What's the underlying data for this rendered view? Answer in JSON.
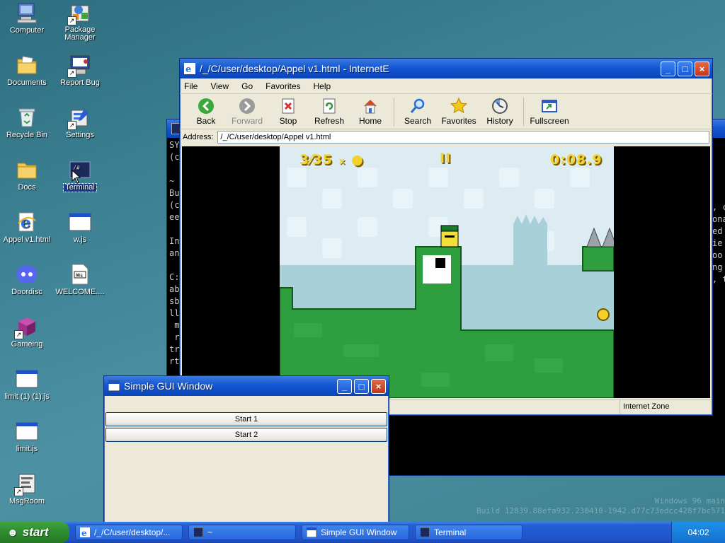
{
  "desktop": {
    "icons": [
      {
        "label": "Computer"
      },
      {
        "label": "Package Manager"
      },
      {
        "label": "Documents"
      },
      {
        "label": "Report Bug"
      },
      {
        "label": "Recycle Bin"
      },
      {
        "label": "Settings"
      },
      {
        "label": "Docs"
      },
      {
        "label": "Terminal"
      },
      {
        "label": "Appel v1.html"
      },
      {
        "label": "w.js"
      },
      {
        "label": "Doordisc"
      },
      {
        "label": "WELCOME...."
      },
      {
        "label": "Gameing"
      },
      {
        "label": "limit (1) (1).js"
      },
      {
        "label": "limit.js"
      },
      {
        "label": "MsgRoom"
      }
    ],
    "watermark_line1": "Windows 96 main",
    "watermark_line2": "Build 12839.88efa932.230410-1942.d77c73edcc428f7bc571"
  },
  "terminal": {
    "title": "#",
    "lines": [
      "SY",
      "(c",
      "",
      "~",
      "Bu",
      "(c",
      "ee",
      "",
      "In",
      "an",
      "",
      "C:",
      "ab",
      "sb",
      "ll",
      " m",
      " r",
      "tr",
      "rt"
    ],
    "right_lines": [
      ", c",
      "ona",
      "ed",
      "ie",
      "oo",
      "ng",
      ", t"
    ]
  },
  "browser": {
    "title": "/_/C/user/desktop/Appel v1.html - InternetE",
    "menu": [
      "File",
      "View",
      "Go",
      "Favorites",
      "Help"
    ],
    "toolbar": {
      "back": "Back",
      "forward": "Forward",
      "stop": "Stop",
      "refresh": "Refresh",
      "home": "Home",
      "search": "Search",
      "favorites": "Favorites",
      "history": "History",
      "fullscreen": "Fullscreen"
    },
    "address_label": "Address:",
    "address_value": "/_/C/user/desktop/Appel v1.html",
    "status_zone": "Internet Zone",
    "game": {
      "apples": "3⁄35",
      "times": "×",
      "pause": "II",
      "timer": "0:08.9"
    }
  },
  "gui_window": {
    "title": "Simple GUI Window",
    "buttons": [
      "Start 1",
      "Start 2"
    ]
  },
  "taskbar": {
    "start_label": "start",
    "tasks": [
      {
        "label": "/_/C/user/desktop/..."
      },
      {
        "label": "~"
      },
      {
        "label": "Simple GUI Window"
      },
      {
        "label": "Terminal"
      }
    ],
    "clock": "04:02"
  }
}
